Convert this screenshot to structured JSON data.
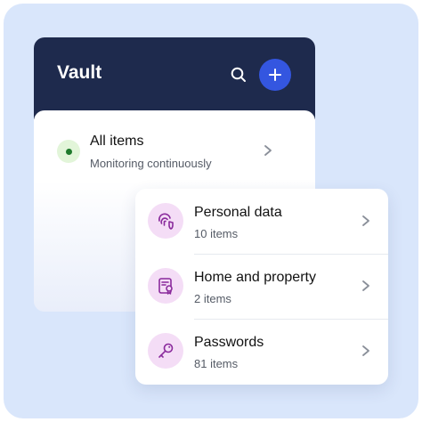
{
  "vault": {
    "title": "Vault",
    "all_items": {
      "title": "All items",
      "subtitle": "Monitoring continuously"
    }
  },
  "categories": [
    {
      "label": "Personal data",
      "count": "10 items",
      "icon": "fingerprint-shield-icon"
    },
    {
      "label": "Home and property",
      "count": "2 items",
      "icon": "document-badge-icon"
    },
    {
      "label": "Passwords",
      "count": "81 items",
      "icon": "key-icon"
    }
  ],
  "colors": {
    "header": "#1e2a4d",
    "accent": "#3456e0",
    "icon_bg": "#f4ddf6",
    "icon_fg": "#8a2a9c",
    "status_green": "#1f7a2c",
    "background": "#d9e6fb"
  }
}
